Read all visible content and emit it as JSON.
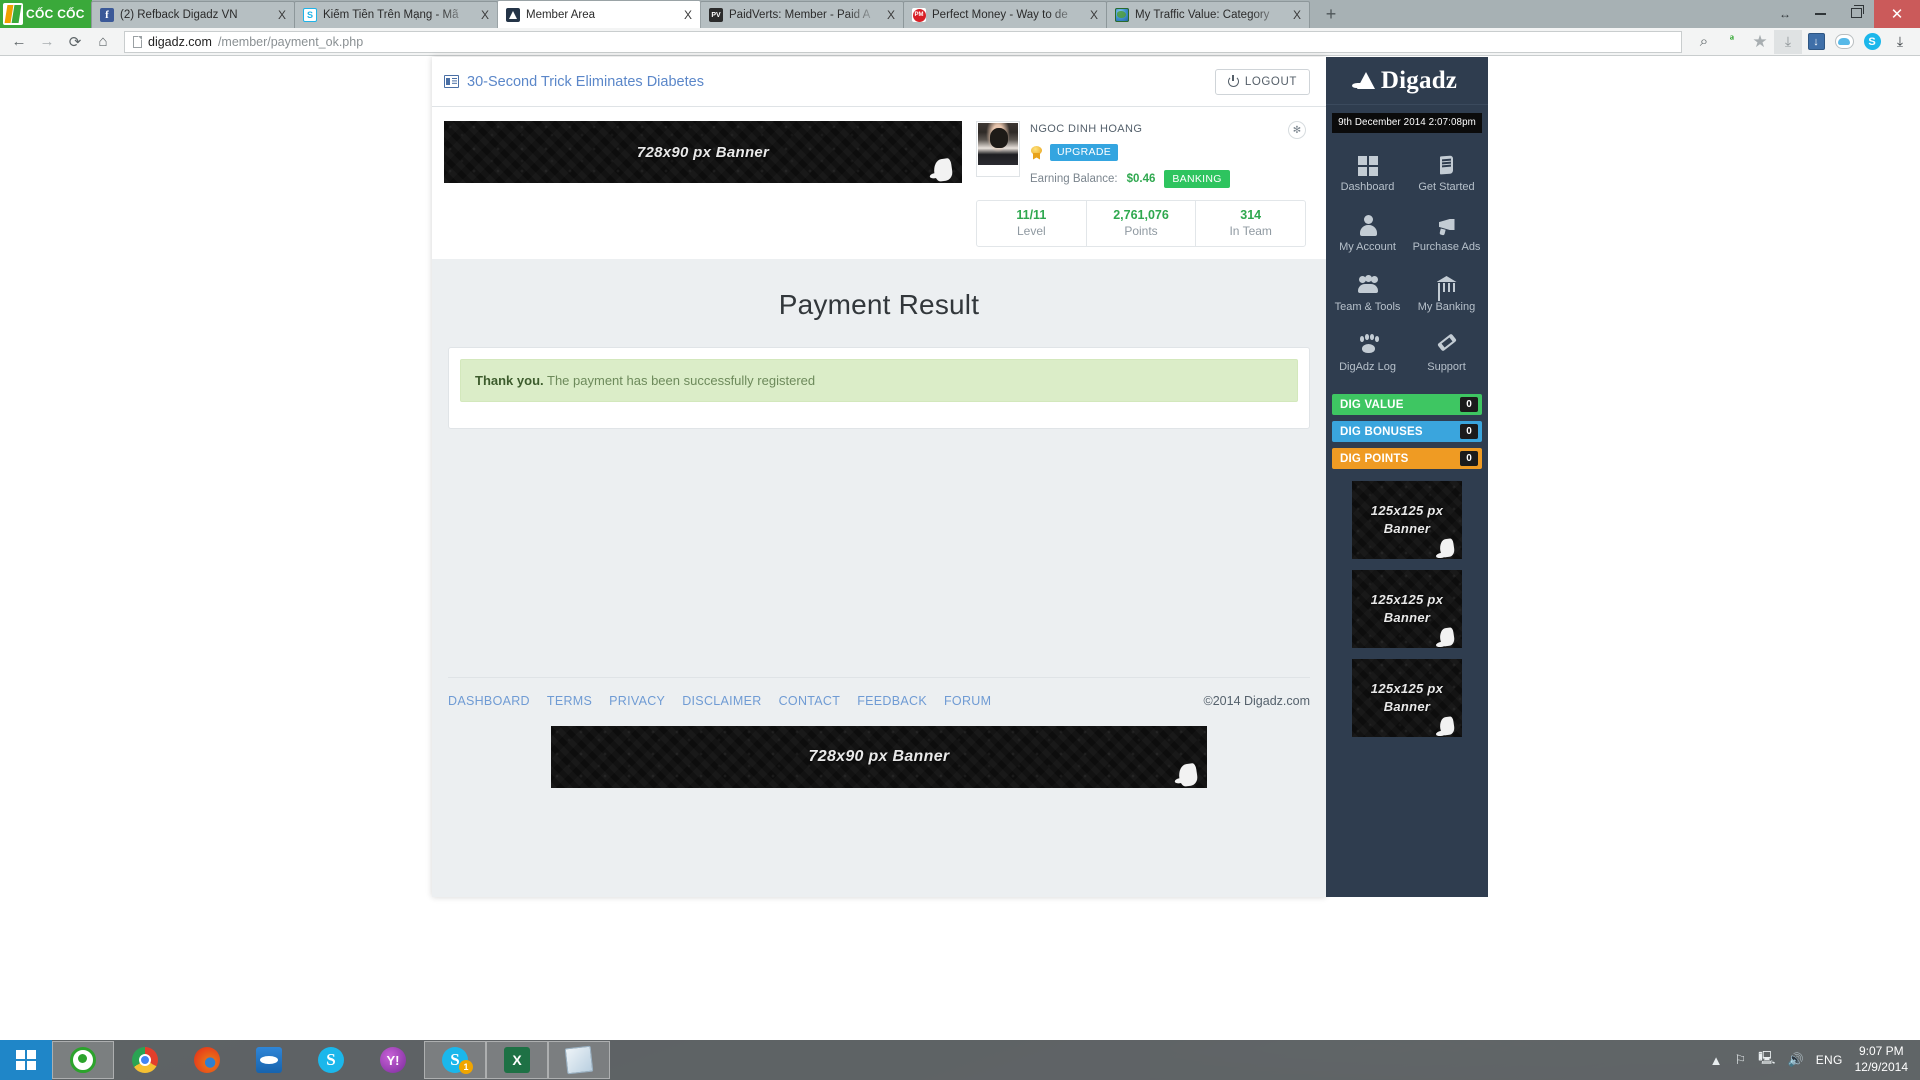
{
  "browser": {
    "brand": "CỐC CỐC",
    "tabs": [
      {
        "label": "(2) Refback Digadz VN",
        "favicon": "facebook-icon",
        "active": false
      },
      {
        "label": "Kiếm Tiền Trên Mạng - Mã",
        "favicon": "skype-circle-icon",
        "active": false
      },
      {
        "label": "Member Area",
        "favicon": "digadz-icon",
        "active": true
      },
      {
        "label": "PaidVerts: Member - Paid A",
        "favicon": "paidverts-icon",
        "active": false
      },
      {
        "label": "Perfect Money - Way to de",
        "favicon": "perfectmoney-icon",
        "active": false
      },
      {
        "label": "My Traffic Value: Category",
        "favicon": "globe-icon",
        "active": false
      }
    ],
    "new_tab_label": "+",
    "close_glyph": "X",
    "window_controls": {
      "restore": "↔",
      "minimize": "—",
      "maximize": "❐",
      "close": "✕"
    },
    "nav": {
      "back": "←",
      "forward": "→",
      "reload": "⟳",
      "home": "⌂",
      "url_host": "digadz.com",
      "url_path": "/member/payment_ok.php",
      "search_icon": "search-icon",
      "adblock_icon": "adblock-icon",
      "star_icon": "bookmark-star-icon",
      "save_icon": "save-page-icon",
      "download_icon": "download-icon",
      "cloud_icon": "cloud-icon",
      "skype_icon": "skype-icon",
      "downloads_icon": "downloads-arrow-icon"
    }
  },
  "page": {
    "header": {
      "ad_link": "30-Second Trick Eliminates Diabetes",
      "ad_icon": "ad-banner-icon",
      "logout_label": "LOGOUT",
      "logout_icon": "power-icon"
    },
    "banner_top": {
      "text": "728x90 px  Banner"
    },
    "profile": {
      "name": "NGOC DINH HOANG",
      "upgrade_label": "UPGRADE",
      "medal_icon": "medal-icon",
      "balance_label": "Earning Balance:",
      "balance_value": "$0.46",
      "banking_label": "BANKING",
      "settings_icon": "gear-icon",
      "stats": [
        {
          "value": "11/11",
          "label": "Level"
        },
        {
          "value": "2,761,076",
          "label": "Points"
        },
        {
          "value": "314",
          "label": "In Team"
        }
      ]
    },
    "main": {
      "title": "Payment Result",
      "alert_strong": "Thank you.",
      "alert_message": "The payment has been successfully registered"
    },
    "footer": {
      "links": [
        "DASHBOARD",
        "TERMS",
        "PRIVACY",
        "DISCLAIMER",
        "CONTACT",
        "FEEDBACK",
        "FORUM"
      ],
      "copyright": "©2014 Digadz.com",
      "banner_text": "728x90 px  Banner"
    }
  },
  "sidebar": {
    "brand": "Digadz",
    "brand_icon": "digadz-rabbit-icon",
    "clock": "9th December 2014 2:07:08pm",
    "nav": [
      {
        "label": "Dashboard",
        "icon": "dashboard-grid-icon"
      },
      {
        "label": "Get Started",
        "icon": "book-icon"
      },
      {
        "label": "My Account",
        "icon": "user-icon"
      },
      {
        "label": "Purchase Ads",
        "icon": "megaphone-icon"
      },
      {
        "label": "Team & Tools",
        "icon": "group-icon"
      },
      {
        "label": "My Banking",
        "icon": "bank-icon"
      },
      {
        "label": "DigAdz Log",
        "icon": "paw-icon"
      },
      {
        "label": "Support",
        "icon": "ribbon-icon"
      }
    ],
    "dig_bars": [
      {
        "label": "DIG VALUE",
        "count": "0",
        "color": "#3ec662"
      },
      {
        "label": "DIG BONUSES",
        "count": "0",
        "color": "#3aa5dd"
      },
      {
        "label": "DIG POINTS",
        "count": "0",
        "color": "#ef9b23"
      }
    ],
    "banners": [
      {
        "line1": "125x125 px",
        "line2": "Banner"
      },
      {
        "line1": "125x125 px",
        "line2": "Banner"
      },
      {
        "line1": "125x125 px",
        "line2": "Banner"
      }
    ]
  },
  "taskbar": {
    "start_icon": "windows-start-icon",
    "items": [
      {
        "icon": "cococ-browser-icon",
        "boxed": true,
        "badge": ""
      },
      {
        "icon": "chrome-icon",
        "boxed": false,
        "badge": ""
      },
      {
        "icon": "firefox-icon",
        "boxed": false,
        "badge": ""
      },
      {
        "icon": "teamviewer-icon",
        "boxed": false,
        "badge": ""
      },
      {
        "icon": "skype-icon",
        "boxed": false,
        "badge": ""
      },
      {
        "icon": "yahoo-messenger-icon",
        "boxed": false,
        "badge": ""
      },
      {
        "icon": "skype-window-icon",
        "boxed": true,
        "badge": "1"
      },
      {
        "icon": "excel-icon",
        "boxed": true,
        "badge": ""
      },
      {
        "icon": "notepad-icon",
        "boxed": true,
        "badge": ""
      }
    ],
    "tray": {
      "show_hidden": "▲",
      "network_icon": "network-flag-icon",
      "monitor_icon": "monitor-icon",
      "volume_icon": "volume-icon",
      "language": "ENG",
      "time": "9:07 PM",
      "date": "12/9/2014"
    }
  }
}
